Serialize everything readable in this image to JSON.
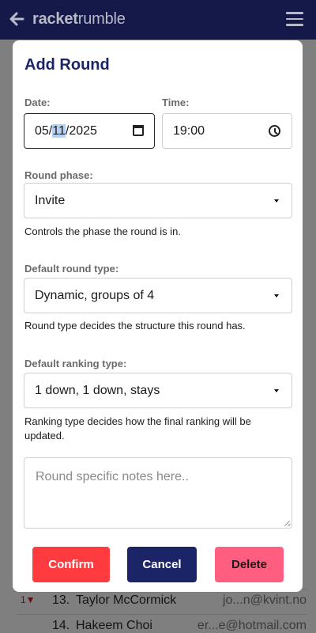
{
  "app": {
    "brand_bold": "racket",
    "brand_regular": "rumble"
  },
  "background_list": [
    {
      "trend": "1▼",
      "rank": "13.",
      "name": "Taylor McCormick",
      "email": "jo...n@kvint.no"
    },
    {
      "trend": "",
      "rank": "14.",
      "name": "Hakeem Choi",
      "email": "er...e@hotmail.com"
    }
  ],
  "modal": {
    "title": "Add Round",
    "date": {
      "label": "Date:",
      "month": "05",
      "day": "11",
      "year": "2025",
      "sep": "/"
    },
    "time": {
      "label": "Time:",
      "value": "19:00"
    },
    "round_phase": {
      "label": "Round phase:",
      "value": "Invite",
      "help": "Controls the phase the round is in."
    },
    "round_type": {
      "label": "Default round type:",
      "value": "Dynamic, groups of 4",
      "help": "Round type decides the structure this round has."
    },
    "ranking_type": {
      "label": "Default ranking type:",
      "value": "1 down, 1 down, stays",
      "help": "Ranking type decides how the final ranking will be updated."
    },
    "notes": {
      "placeholder": "Round specific notes here.."
    },
    "buttons": {
      "confirm": "Confirm",
      "cancel": "Cancel",
      "delete": "Delete"
    }
  },
  "colors": {
    "header_bg": "#14194a",
    "overlay": "#7f7f7f",
    "title": "#1c2468",
    "confirm": "#ff3b3f",
    "cancel": "#1c2468",
    "delete": "#ff5e80"
  },
  "icons": {
    "back": "back-arrow-icon",
    "menu": "hamburger-menu-icon",
    "calendar": "calendar-icon",
    "clock": "clock-icon",
    "dropdown": "chevron-down-icon",
    "resize": "resize-handle-icon"
  }
}
